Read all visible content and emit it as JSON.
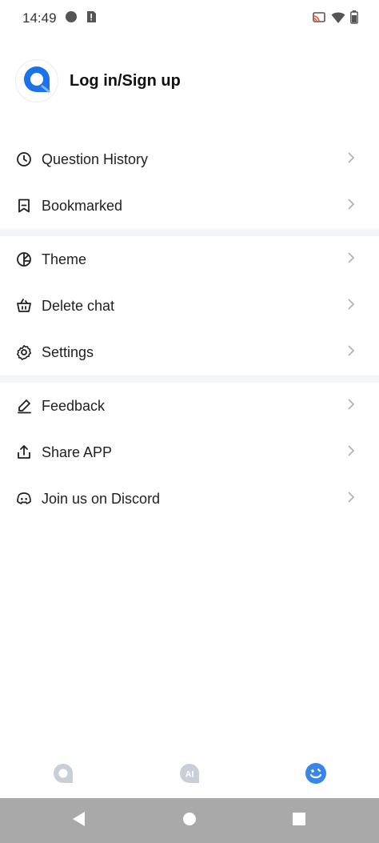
{
  "status_bar": {
    "time": "14:49",
    "left_icons": [
      "circle-notification-icon",
      "alert-notification-icon"
    ],
    "right_icons": [
      "cast-icon",
      "wifi-icon",
      "battery-icon"
    ]
  },
  "profile": {
    "avatar_icon": "chat-bubble-logo-icon",
    "login_label": "Log in/Sign up",
    "accent_color": "#1a73e8"
  },
  "menu": {
    "groups": [
      {
        "items": [
          {
            "label": "Question History",
            "icon": "clock-icon"
          },
          {
            "label": "Bookmarked",
            "icon": "bookmark-icon"
          }
        ]
      },
      {
        "items": [
          {
            "label": "Theme",
            "icon": "theme-icon"
          },
          {
            "label": "Delete chat",
            "icon": "basket-icon"
          },
          {
            "label": "Settings",
            "icon": "gear-icon"
          }
        ]
      },
      {
        "items": [
          {
            "label": "Feedback",
            "icon": "pencil-icon"
          },
          {
            "label": "Share APP",
            "icon": "share-icon"
          },
          {
            "label": "Join us on Discord",
            "icon": "discord-icon"
          }
        ]
      }
    ]
  },
  "bottom_tabs": [
    {
      "icon": "chat-tab-icon",
      "active": false
    },
    {
      "icon": "ai-tab-icon",
      "active": false
    },
    {
      "icon": "smiley-tab-icon",
      "active": true
    }
  ],
  "nav_bar": {
    "buttons": [
      "back-icon",
      "home-icon",
      "recents-icon"
    ]
  },
  "colors": {
    "active_tab": "#3a86e8",
    "inactive_tab": "#c9cfd8",
    "divider": "#f4f5f7",
    "chevron": "#b3b3b3"
  }
}
